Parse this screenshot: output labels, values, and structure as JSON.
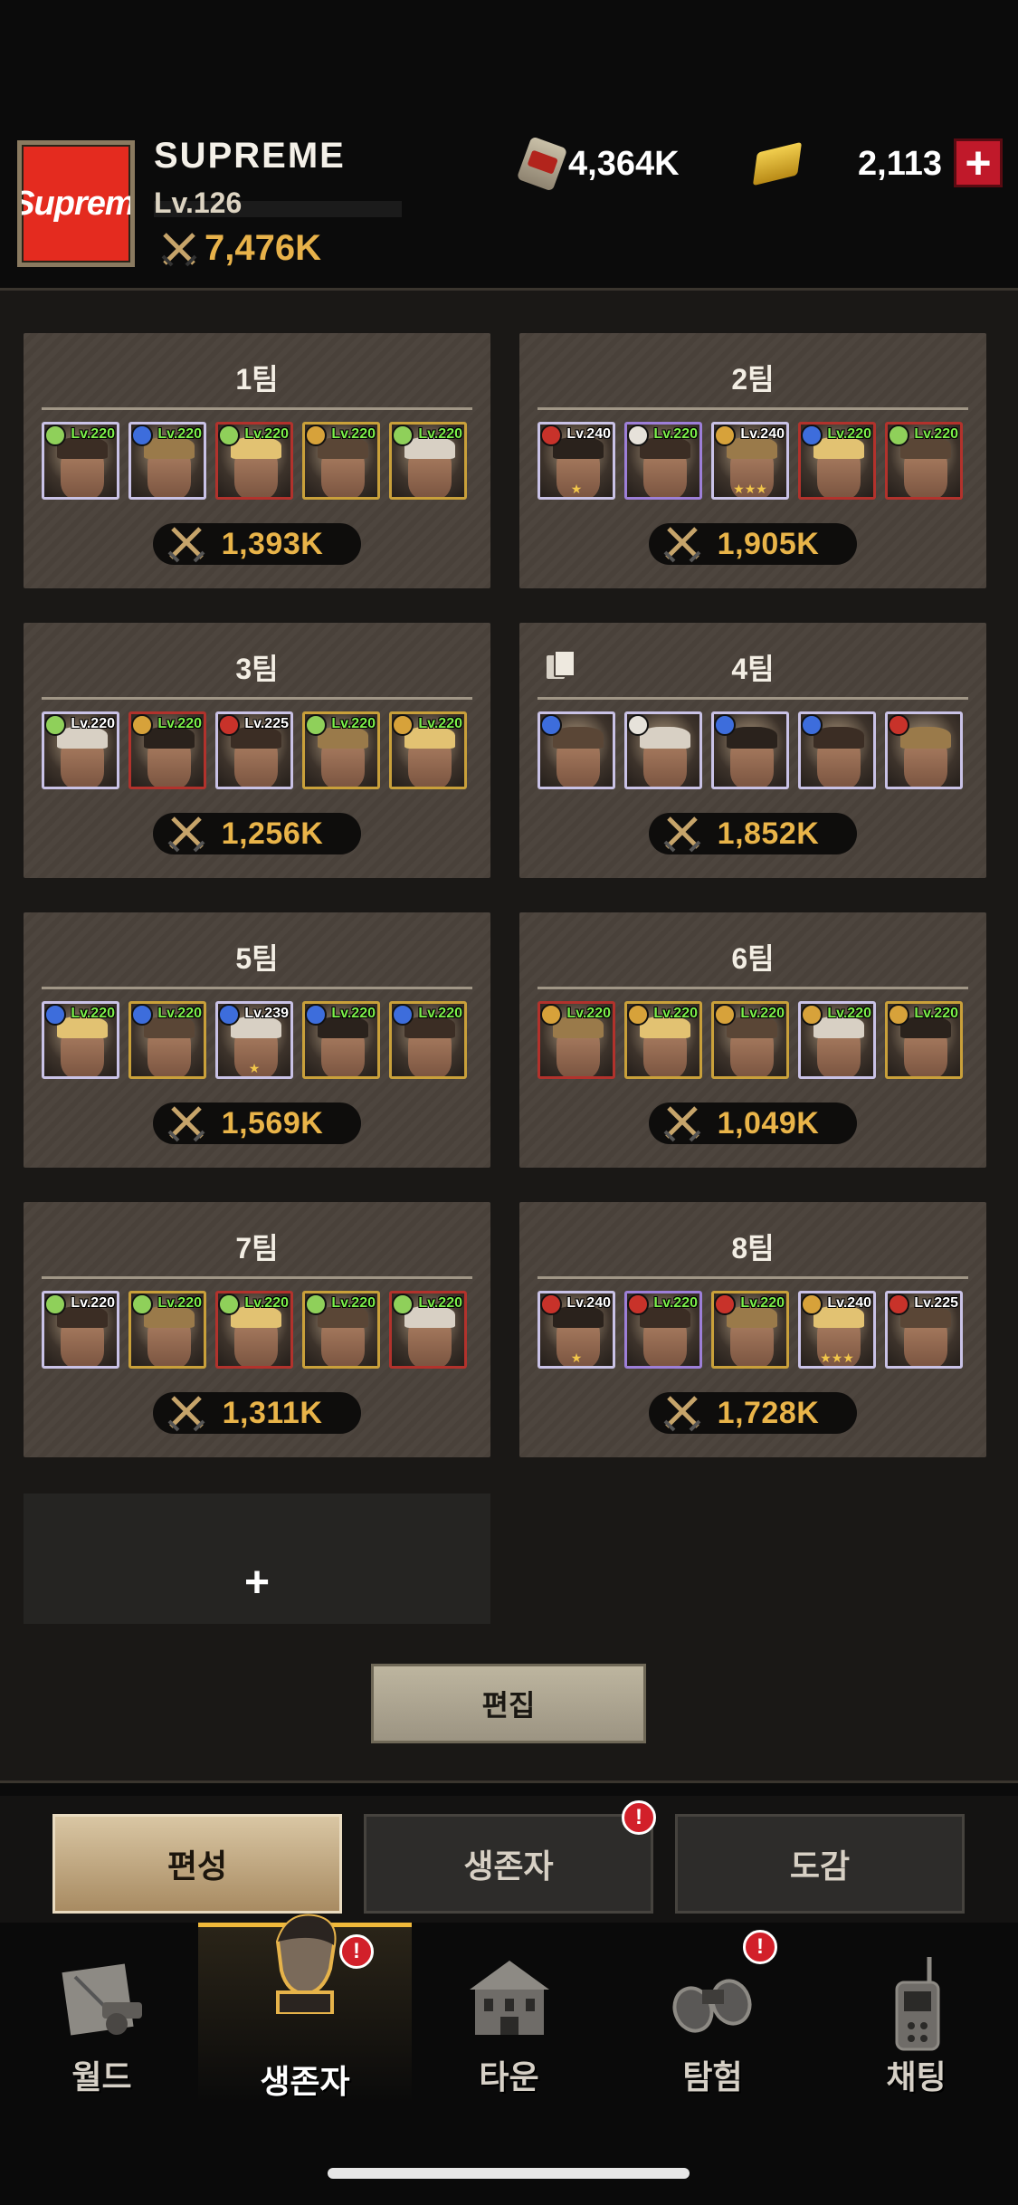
{
  "player": {
    "avatar_text": "Supreme",
    "name": "SUPREME",
    "level": "Lv.126",
    "power": "7,476K"
  },
  "currencies": [
    {
      "icon": "can-icon",
      "value": "4,364K"
    },
    {
      "icon": "gold-bar-icon",
      "value": "2,113"
    }
  ],
  "add_currency_label": "+",
  "teams": [
    {
      "name": "1팀",
      "power": "1,393K",
      "heroes": [
        {
          "lv": "Lv.220",
          "cls": "green",
          "border": "white",
          "lvcolor": "g"
        },
        {
          "lv": "Lv.220",
          "cls": "blue",
          "border": "white",
          "lvcolor": "g"
        },
        {
          "lv": "Lv.220",
          "cls": "green",
          "border": "red",
          "lvcolor": "g"
        },
        {
          "lv": "Lv.220",
          "cls": "gold",
          "border": "gold",
          "lvcolor": "g"
        },
        {
          "lv": "Lv.220",
          "cls": "green",
          "border": "gold",
          "lvcolor": "g"
        }
      ]
    },
    {
      "name": "2팀",
      "power": "1,905K",
      "heroes": [
        {
          "lv": "Lv.240",
          "cls": "red",
          "border": "white",
          "lvcolor": "w",
          "stars": "★"
        },
        {
          "lv": "Lv.220",
          "cls": "white",
          "border": "purple",
          "lvcolor": "g"
        },
        {
          "lv": "Lv.240",
          "cls": "gold",
          "border": "white",
          "lvcolor": "w",
          "stars": "★★★"
        },
        {
          "lv": "Lv.220",
          "cls": "blue",
          "border": "red",
          "lvcolor": "g"
        },
        {
          "lv": "Lv.220",
          "cls": "green",
          "border": "red",
          "lvcolor": "g"
        }
      ]
    },
    {
      "name": "3팀",
      "power": "1,256K",
      "heroes": [
        {
          "lv": "Lv.220",
          "cls": "green",
          "border": "white",
          "lvcolor": "w"
        },
        {
          "lv": "Lv.220",
          "cls": "gold",
          "border": "red",
          "lvcolor": "g"
        },
        {
          "lv": "Lv.225",
          "cls": "red",
          "border": "white",
          "lvcolor": "w"
        },
        {
          "lv": "Lv.220",
          "cls": "green",
          "border": "gold",
          "lvcolor": "g"
        },
        {
          "lv": "Lv.220",
          "cls": "gold",
          "border": "gold",
          "lvcolor": "g"
        }
      ]
    },
    {
      "name": "4팀",
      "power": "1,852K",
      "show_doc_icon": true,
      "heroes": [
        {
          "lv": "",
          "cls": "blue",
          "border": "white",
          "lvcolor": "g"
        },
        {
          "lv": "",
          "cls": "white",
          "border": "white",
          "lvcolor": "g"
        },
        {
          "lv": "",
          "cls": "blue",
          "border": "white",
          "lvcolor": "g"
        },
        {
          "lv": "",
          "cls": "blue",
          "border": "white",
          "lvcolor": "g"
        },
        {
          "lv": "",
          "cls": "red",
          "border": "white",
          "lvcolor": "g"
        }
      ]
    },
    {
      "name": "5팀",
      "power": "1,569K",
      "heroes": [
        {
          "lv": "Lv.220",
          "cls": "blue",
          "border": "white",
          "lvcolor": "g"
        },
        {
          "lv": "Lv.220",
          "cls": "blue",
          "border": "gold",
          "lvcolor": "g"
        },
        {
          "lv": "Lv.239",
          "cls": "blue",
          "border": "white",
          "lvcolor": "w",
          "stars": "★"
        },
        {
          "lv": "Lv.220",
          "cls": "blue",
          "border": "gold",
          "lvcolor": "g"
        },
        {
          "lv": "Lv.220",
          "cls": "blue",
          "border": "gold",
          "lvcolor": "g"
        }
      ]
    },
    {
      "name": "6팀",
      "power": "1,049K",
      "heroes": [
        {
          "lv": "Lv.220",
          "cls": "gold",
          "border": "red",
          "lvcolor": "g"
        },
        {
          "lv": "Lv.220",
          "cls": "gold",
          "border": "gold",
          "lvcolor": "g"
        },
        {
          "lv": "Lv.220",
          "cls": "gold",
          "border": "gold",
          "lvcolor": "g"
        },
        {
          "lv": "Lv.220",
          "cls": "gold",
          "border": "white",
          "lvcolor": "g"
        },
        {
          "lv": "Lv.220",
          "cls": "gold",
          "border": "gold",
          "lvcolor": "g"
        }
      ]
    },
    {
      "name": "7팀",
      "power": "1,311K",
      "heroes": [
        {
          "lv": "Lv.220",
          "cls": "green",
          "border": "white",
          "lvcolor": "w"
        },
        {
          "lv": "Lv.220",
          "cls": "green",
          "border": "gold",
          "lvcolor": "g"
        },
        {
          "lv": "Lv.220",
          "cls": "green",
          "border": "red",
          "lvcolor": "g"
        },
        {
          "lv": "Lv.220",
          "cls": "green",
          "border": "gold",
          "lvcolor": "g"
        },
        {
          "lv": "Lv.220",
          "cls": "green",
          "border": "red",
          "lvcolor": "g"
        }
      ]
    },
    {
      "name": "8팀",
      "power": "1,728K",
      "heroes": [
        {
          "lv": "Lv.240",
          "cls": "red",
          "border": "white",
          "lvcolor": "w",
          "stars": "★"
        },
        {
          "lv": "Lv.220",
          "cls": "red",
          "border": "purple",
          "lvcolor": "g"
        },
        {
          "lv": "Lv.220",
          "cls": "red",
          "border": "gold",
          "lvcolor": "g"
        },
        {
          "lv": "Lv.240",
          "cls": "gold",
          "border": "white",
          "lvcolor": "w",
          "stars": "★★★"
        },
        {
          "lv": "Lv.225",
          "cls": "red",
          "border": "white",
          "lvcolor": "w"
        }
      ]
    }
  ],
  "add_team_label": "+",
  "edit_label": "편집",
  "sub_tabs": [
    {
      "label": "편성",
      "active": true
    },
    {
      "label": "생존자",
      "active": false,
      "badge": "!"
    },
    {
      "label": "도감",
      "active": false
    }
  ],
  "nav": [
    {
      "label": "월드",
      "icon": "world-icon"
    },
    {
      "label": "생존자",
      "icon": "survivor-icon",
      "active": true,
      "badge": "!"
    },
    {
      "label": "타운",
      "icon": "town-icon"
    },
    {
      "label": "탐험",
      "icon": "binoculars-icon",
      "badge": "!"
    },
    {
      "label": "채팅",
      "icon": "radio-icon"
    }
  ],
  "colors": {
    "accent_gold": "#e9b449",
    "badge_red": "#d2202a",
    "card_bg": "#4a423b"
  }
}
